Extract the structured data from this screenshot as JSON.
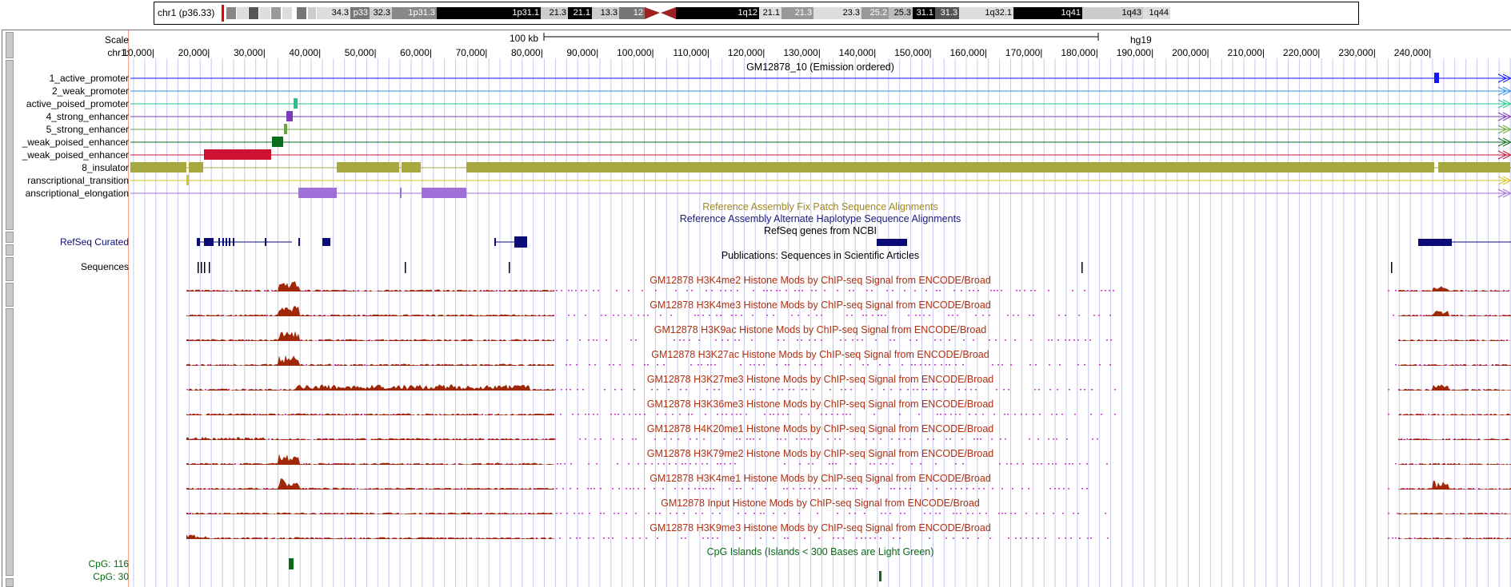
{
  "ideogram": {
    "label": "chr1 (p36.33)",
    "bands": [
      "34.3",
      "p33",
      "32.3",
      "1p31.3",
      "1p31.1",
      "21.3",
      "21.1",
      "13.3",
      "12",
      "1q12",
      "21.1",
      "21.3",
      "23.3",
      "25.2",
      "25.3",
      "31.1",
      "31.3",
      "1q32.1",
      "1q41",
      "1q43",
      "1q44"
    ]
  },
  "ruler": {
    "scale_label": "Scale",
    "chrom_label": "chr1:",
    "scale_text": "100 kb",
    "assembly": "hg19",
    "ticks": [
      "10,000",
      "20,000",
      "30,000",
      "40,000",
      "50,000",
      "60,000",
      "70,000",
      "80,000",
      "90,000",
      "100,000",
      "110,000",
      "120,000",
      "130,000",
      "140,000",
      "150,000",
      "160,000",
      "170,000",
      "180,000",
      "190,000",
      "200,000",
      "210,000",
      "220,000",
      "230,000",
      "240,000"
    ],
    "track_title": "GM12878_10 (Emission ordered)"
  },
  "chromhmm": [
    {
      "label": "1_active_promoter",
      "color": "#1515ff"
    },
    {
      "label": "2_weak_promoter",
      "color": "#3090e0"
    },
    {
      "label": "active_poised_promoter",
      "color": "#22c48a"
    },
    {
      "label": "4_strong_enhancer",
      "color": "#7a3db5"
    },
    {
      "label": "5_strong_enhancer",
      "color": "#6aa63a"
    },
    {
      "label": "_weak_poised_enhancer",
      "color": "#0b6d1c"
    },
    {
      "label": "_weak_poised_enhancer",
      "color": "#cc1133"
    },
    {
      "label": "8_insulator",
      "color": "#a8a840"
    },
    {
      "label": "ranscriptional_transition",
      "color": "#d7c520"
    },
    {
      "label": "anscriptional_elongation",
      "color": "#a070d8"
    }
  ],
  "fix_patch_title": "Reference Assembly Fix Patch Sequence Alignments",
  "alt_haplotype_title": "Reference Assembly Alternate Haplotype Sequence Alignments",
  "refseq": {
    "title": "RefSeq genes from NCBI",
    "label": "RefSeq Curated"
  },
  "publications": {
    "title": "Publications: Sequences in Scientific Articles",
    "label": "Sequences"
  },
  "histone_tracks": [
    "GM12878 H3K4me2 Histone Mods by ChIP-seq Signal from ENCODE/Broad",
    "GM12878 H3K4me3 Histone Mods by ChIP-seq Signal from ENCODE/Broad",
    "GM12878 H3K9ac Histone Mods by ChIP-seq Signal from ENCODE/Broad",
    "GM12878 H3K27ac Histone Mods by ChIP-seq Signal from ENCODE/Broad",
    "GM12878 H3K27me3 Histone Mods by ChIP-seq Signal from ENCODE/Broad",
    "GM12878 H3K36me3 Histone Mods by ChIP-seq Signal from ENCODE/Broad",
    "GM12878 H4K20me1 Histone Mods by ChIP-seq Signal from ENCODE/Broad",
    "GM12878 H3K79me2 Histone Mods by ChIP-seq Signal from ENCODE/Broad",
    "GM12878 H3K4me1 Histone Mods by ChIP-seq Signal from ENCODE/Broad",
    "GM12878 Input Histone Mods by ChIP-seq Signal from ENCODE/Broad",
    "GM12878 H3K9me3 Histone Mods by ChIP-seq Signal from ENCODE/Broad"
  ],
  "cpg": {
    "title": "CpG Islands (Islands < 300 Bases are Light Green)",
    "label_1": "CpG: 116",
    "label_2": "CpG: 30"
  },
  "colors": {
    "histone_title": "#b03010",
    "signal": "#a02808",
    "gap_dots": "#cc33cc",
    "grid": "#c8c8f0",
    "cpg": "#0a6a14",
    "refseq": "#0c0c78",
    "fix_patch": "#a08820",
    "alt_hap": "#1a1a7a"
  }
}
